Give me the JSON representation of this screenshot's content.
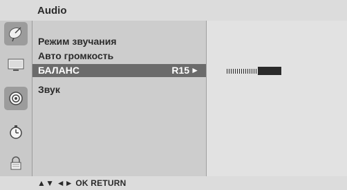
{
  "header": {
    "title": "Audio"
  },
  "sidebar": {
    "icons": [
      {
        "name": "satellite-dish-icon",
        "active": true
      },
      {
        "name": "tv-screen-icon",
        "active": false
      },
      {
        "name": "speaker-icon",
        "active": true
      },
      {
        "name": "clock-icon",
        "active": false
      },
      {
        "name": "lock-icon",
        "active": false
      }
    ]
  },
  "menu": {
    "items": [
      {
        "label": "Режим звучания"
      },
      {
        "label": "Авто громкость"
      },
      {
        "label": "БАЛАНС",
        "value": "R15",
        "arrow": "►",
        "selected": true
      },
      {
        "label": "Звук"
      }
    ]
  },
  "balance": {
    "value": 15,
    "min": -50,
    "max": 50
  },
  "footer": {
    "hint": "▲▼  ◄►  OK  RETURN"
  },
  "colors": {
    "selection": "#6b6b6b",
    "menu_bg": "#cdcdcd",
    "panel_bg": "#e2e2e2"
  }
}
